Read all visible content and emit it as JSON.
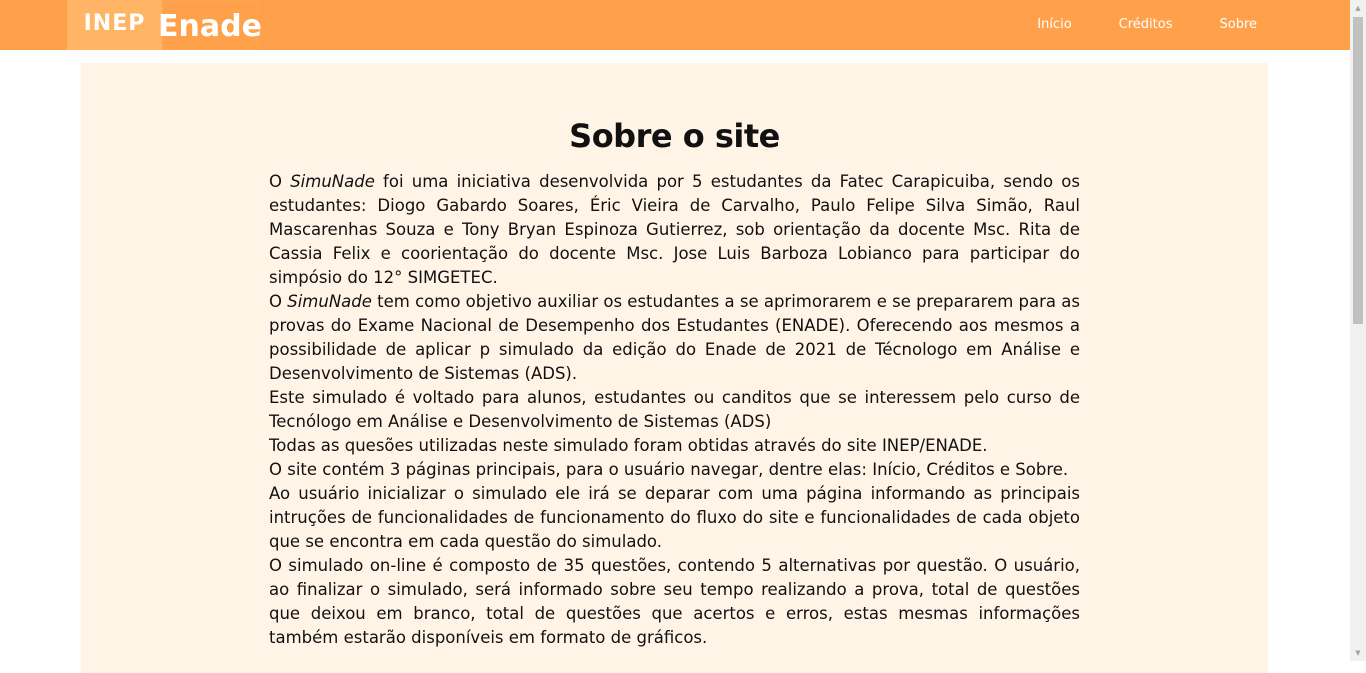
{
  "header": {
    "logo_inep": "INEP",
    "logo_enade": "Enade",
    "nav": [
      {
        "label": "Início"
      },
      {
        "label": "Créditos"
      },
      {
        "label": "Sobre"
      }
    ]
  },
  "main": {
    "title": "Sobre o site",
    "paragraphs": {
      "p1_prefix": "O ",
      "p1_brand": "SimuNade",
      "p1_rest": " foi uma iniciativa desenvolvida por 5 estudantes da Fatec Carapicuiba, sendo os estudantes: Diogo Gabardo Soares, Éric Vieira de Carvalho, Paulo Felipe Silva Simão, Raul Mascarenhas Souza e Tony Bryan Espinoza Gutierrez, sob orientação da docente Msc. Rita de Cassia Felix e coorientação do docente Msc. Jose Luis Barboza Lobianco para participar do simpósio do 12° SIMGETEC.",
      "p2_prefix": "O ",
      "p2_brand": "SimuNade",
      "p2_rest": " tem como objetivo auxiliar os estudantes a se aprimorarem e se prepararem para as provas do Exame Nacional de Desempenho dos Estudantes (ENADE). Oferecendo aos mesmos a possibilidade de aplicar p simulado da edição do Enade de 2021 de Técnologo em Análise e Desenvolvimento de Sistemas (ADS).",
      "p3": "Este simulado é voltado para alunos, estudantes ou canditos que se interessem pelo curso de Tecnólogo em Análise e Desenvolvimento de Sistemas (ADS)",
      "p4": "Todas as quesões utilizadas neste simulado foram obtidas através do site INEP/ENADE.",
      "p5": "O site contém 3 páginas principais, para o usuário navegar, dentre elas: Início, Créditos e Sobre.",
      "p6": "Ao usuário inicializar o simulado ele irá se deparar com uma página informando as principais intruções de funcionalidades de funcionamento do fluxo do site e funcionalidades de cada objeto que se encontra em cada questão do simulado.",
      "p7": "O simulado on-line é composto de 35 questões, contendo 5 alternativas por questão. O usuário, ao finalizar o simulado, será informado sobre seu tempo realizando a prova, total de questões que deixou em branco, total de questões que acertos e erros, estas mesmas informações também estarão disponíveis em formato de gráficos."
    }
  },
  "colors": {
    "navbar": "#ffa14a",
    "content_bg": "#fff4e6",
    "text": "#111111"
  }
}
